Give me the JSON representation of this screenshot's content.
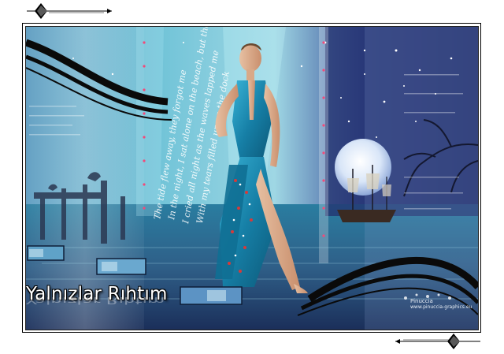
{
  "title": "Yalnızlar Rıhtım",
  "credit": {
    "name": "Pinuccia",
    "site": "www.pinuccia-graphics.eu"
  },
  "poem_lines": [
    "The tide flew away, they forgot me",
    "In the night, I sat alone on the beach, but the sea",
    "I cried all night as the waves lapped me",
    "With my tears filled up on the dock"
  ],
  "colors": {
    "teal": "#1f8fb3",
    "deep_blue": "#1c2a66",
    "dress": "#1a86aa",
    "frame": "#000000"
  }
}
